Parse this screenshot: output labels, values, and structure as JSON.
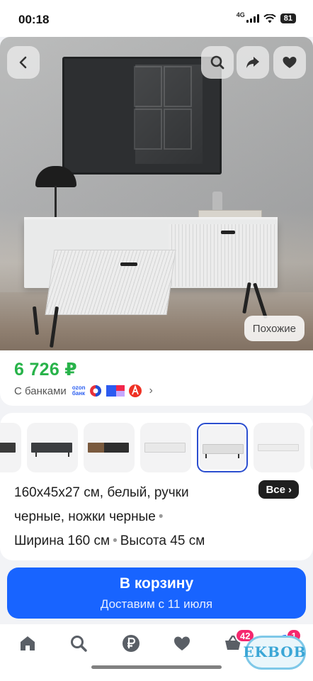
{
  "status_bar": {
    "time": "00:18",
    "network": "4G",
    "battery": "81"
  },
  "hero": {
    "back_icon": "chevron-left-icon",
    "search_icon": "search-icon",
    "share_icon": "share-arrow-icon",
    "favorite_icon": "heart-icon",
    "similar_label": "Похожие"
  },
  "price_block": {
    "price": "6 726 ₽",
    "price_color": "#28b34a",
    "bank_label": "С банками",
    "ozon_line1": "ozon",
    "ozon_line2": "банк"
  },
  "variants": {
    "thumbs": [
      {
        "color": "#3a3a3a"
      },
      {
        "color": "#3b3d40"
      },
      {
        "color": "#7a5a3e"
      },
      {
        "color": "#e8e8e8"
      },
      {
        "color": "#dedede",
        "selected": true
      },
      {
        "color": "#ececec"
      },
      {
        "color": "#b9a390"
      }
    ]
  },
  "description": {
    "line1": "160x45x27 см, белый, ручки",
    "line2": "черные, ножки черные",
    "dims_width": "Ширина 160 см",
    "dims_height": "Высота 45 см",
    "all_label": "Все"
  },
  "cart_button": {
    "title": "В корзину",
    "subtitle": "Доставим с 11 июля",
    "color": "#1864ff"
  },
  "bottom_nav": {
    "items": [
      "home-icon",
      "search-icon",
      "ruble-icon",
      "heart-icon",
      "cart-icon",
      "profile-icon"
    ],
    "cart_badge": "42",
    "profile_badge": "1"
  },
  "watermark": {
    "text": "EKBOB"
  }
}
